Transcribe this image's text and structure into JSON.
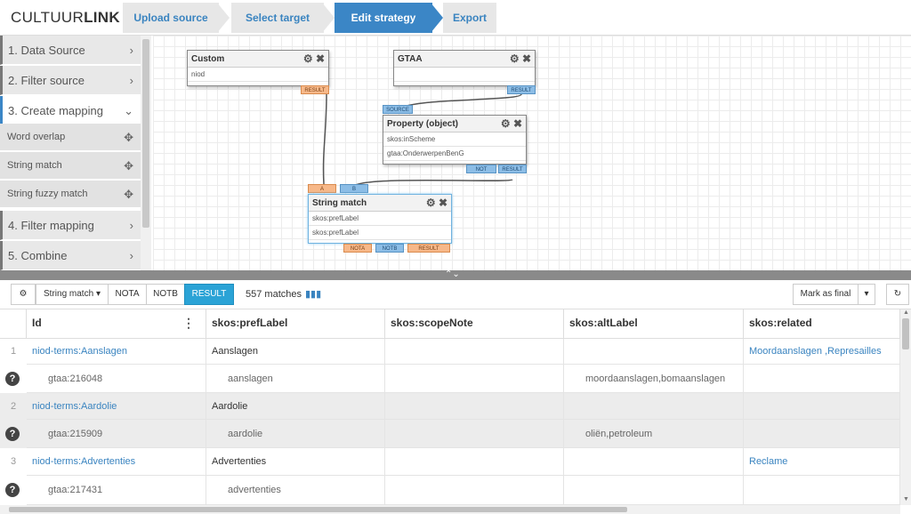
{
  "logo": {
    "part1": "CULTUUR",
    "part2": "LINK"
  },
  "steps": [
    {
      "label": "Upload source",
      "active": false
    },
    {
      "label": "Select target",
      "active": false
    },
    {
      "label": "Edit strategy",
      "active": true
    },
    {
      "label": "Export",
      "active": false
    }
  ],
  "sidebar": {
    "items": [
      {
        "label": "1. Data Source",
        "icon": "chevron-right-icon"
      },
      {
        "label": "2. Filter source",
        "icon": "chevron-right-icon"
      },
      {
        "label": "3. Create mapping",
        "icon": "chevron-down-icon"
      },
      {
        "label": "4. Filter mapping",
        "icon": "chevron-right-icon"
      },
      {
        "label": "5. Combine",
        "icon": "chevron-right-icon"
      }
    ],
    "subitems": [
      {
        "label": "Word overlap",
        "icon": "move-icon"
      },
      {
        "label": "String match",
        "icon": "move-icon"
      },
      {
        "label": "String fuzzy match",
        "icon": "move-icon"
      }
    ]
  },
  "nodes": {
    "custom": {
      "title": "Custom",
      "rows": [
        "niod"
      ],
      "ports": [
        "RESULT"
      ]
    },
    "gtaa": {
      "title": "GTAA",
      "rows": [
        ""
      ],
      "ports": [
        "RESULT"
      ]
    },
    "property": {
      "title": "Property (object)",
      "rows": [
        "skos:inScheme",
        "gtaa:OnderwerpenBenG"
      ],
      "ports": [
        "SOURCE",
        "NOT",
        "RESULT"
      ]
    },
    "stringmatch": {
      "title": "String match",
      "rows": [
        "skos:prefLabel",
        "skos:prefLabel"
      ],
      "ports": [
        "A",
        "B",
        "NOTA",
        "NOTB",
        "RESULT"
      ]
    }
  },
  "toolbar": {
    "dropdown": "String match",
    "filters": [
      "NOTA",
      "NOTB",
      "RESULT"
    ],
    "active_filter": "RESULT",
    "matches": "557 matches",
    "mark_final": "Mark as final"
  },
  "table": {
    "columns": [
      "Id",
      "skos:prefLabel",
      "skos:scopeNote",
      "skos:altLabel",
      "skos:related"
    ],
    "rows": [
      {
        "num": "1",
        "id": "niod-terms:Aanslagen",
        "prefLabel": "Aanslagen",
        "scopeNote": "",
        "altLabel": "",
        "related": "Moordaanslagen ,Represailles",
        "match": {
          "id": "gtaa:216048",
          "prefLabel": "aanslagen",
          "scopeNote": "",
          "altLabel": "moordaanslagen,bomaanslagen",
          "related": ""
        }
      },
      {
        "num": "2",
        "id": "niod-terms:Aardolie",
        "prefLabel": "Aardolie",
        "scopeNote": "",
        "altLabel": "",
        "related": "",
        "match": {
          "id": "gtaa:215909",
          "prefLabel": "aardolie",
          "scopeNote": "",
          "altLabel": "oliën,petroleum",
          "related": ""
        }
      },
      {
        "num": "3",
        "id": "niod-terms:Advertenties",
        "prefLabel": "Advertenties",
        "scopeNote": "",
        "altLabel": "",
        "related": "Reclame",
        "match": {
          "id": "gtaa:217431",
          "prefLabel": "advertenties",
          "scopeNote": "",
          "altLabel": "",
          "related": ""
        }
      }
    ]
  },
  "colors": {
    "accent": "#3b86c6",
    "active_filter": "#2ba3d6",
    "link": "#3a84c0",
    "port_orange": "#f7b889",
    "port_blue": "#8cbde6"
  }
}
